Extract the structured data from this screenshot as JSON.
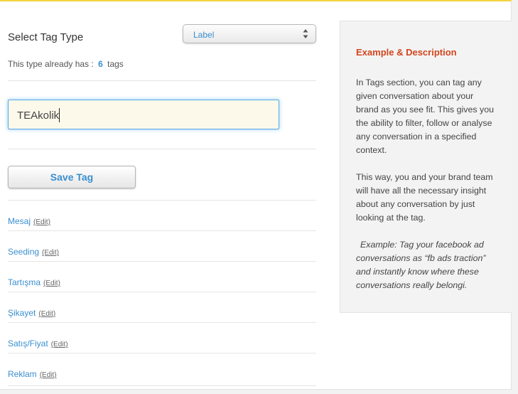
{
  "colors": {
    "accent": "#3a8fd0",
    "heading_red": "#d2461d",
    "top_border": "#f4d33c"
  },
  "form": {
    "title": "Select Tag Type",
    "type_select": {
      "value": "Label"
    },
    "count": {
      "prefix": "This type already has :",
      "value": "6",
      "suffix": "tags"
    },
    "tag_input": {
      "value": "TEAkolik"
    },
    "save_label": "Save Tag"
  },
  "tags": [
    {
      "name": "Mesaj",
      "edit": "(Edit)"
    },
    {
      "name": "Seeding",
      "edit": "(Edit)"
    },
    {
      "name": "Tartışma",
      "edit": "(Edit)"
    },
    {
      "name": "Şikayet",
      "edit": "(Edit)"
    },
    {
      "name": "Satış/Fiyat",
      "edit": "(Edit)"
    },
    {
      "name": "Reklam",
      "edit": "(Edit)"
    }
  ],
  "sidebar": {
    "title": "Example & Description",
    "para1": "In Tags section, you can tag any given conversation about your brand as you see fit. This gives you the ability to filter, follow or analyse any conversation in a specified context.",
    "para2": "This way, you and your brand team will have all the necessary insight about any conversation by just looking at the tag.",
    "example": "Example: Tag your facebook ad conversations as “fb ads traction” and instantly know where these conversations really belongi."
  }
}
